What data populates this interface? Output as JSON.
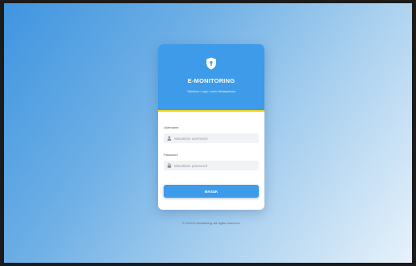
{
  "app": {
    "title": "E-MONITORING",
    "subtitle": "Silahkan Login untuk Melanjutkan"
  },
  "form": {
    "username_label": "Username",
    "username_placeholder": "Masukkan username",
    "password_label": "Password",
    "password_placeholder": "Masukkan password",
    "submit_label": "MASUK"
  },
  "footer": {
    "text": "© 2024 E-Monitoring. All rights reserved."
  },
  "colors": {
    "primary": "#3d9be9",
    "accent": "#f2d21a",
    "background_start": "#3f95e0",
    "background_end": "#e7f2fb"
  },
  "icons": {
    "logo": "shield-icon",
    "username": "user-icon",
    "password": "lock-icon"
  }
}
